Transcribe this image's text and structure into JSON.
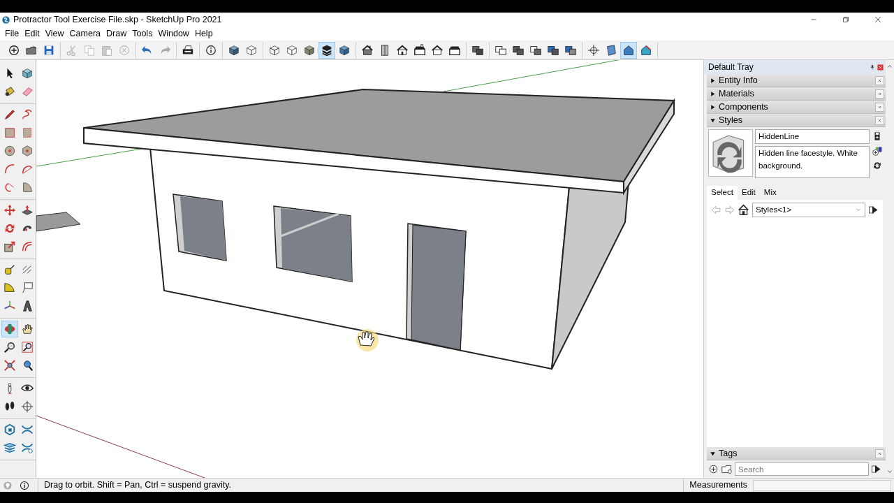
{
  "window": {
    "title": "Protractor Tool Exercise File.skp - SketchUp Pro 2021"
  },
  "menu": [
    "File",
    "Edit",
    "View",
    "Camera",
    "Draw",
    "Tools",
    "Window",
    "Help"
  ],
  "toolbar": [
    {
      "items": [
        {
          "kind": "new",
          "selected": false
        },
        {
          "kind": "open",
          "selected": false
        },
        {
          "kind": "save",
          "selected": false
        }
      ]
    },
    {
      "items": [
        {
          "kind": "cut",
          "selected": false
        },
        {
          "kind": "copy",
          "selected": false
        },
        {
          "kind": "paste",
          "selected": false
        },
        {
          "kind": "erase",
          "selected": false
        }
      ]
    },
    {
      "items": [
        {
          "kind": "undo",
          "selected": false
        },
        {
          "kind": "redo",
          "selected": false
        }
      ]
    },
    {
      "items": [
        {
          "kind": "print",
          "selected": false
        }
      ]
    },
    {
      "items": [
        {
          "kind": "info",
          "selected": false
        }
      ]
    },
    {
      "items": [
        {
          "kind": "xray",
          "selected": false
        },
        {
          "kind": "backedges",
          "selected": false
        }
      ]
    },
    {
      "items": [
        {
          "kind": "wireframe",
          "selected": false
        },
        {
          "kind": "hiddenline",
          "selected": false
        },
        {
          "kind": "shaded",
          "selected": false
        },
        {
          "kind": "textured",
          "selected": true
        },
        {
          "kind": "monochrome",
          "selected": false
        }
      ]
    },
    {
      "items": [
        {
          "kind": "iso",
          "selected": false
        },
        {
          "kind": "top",
          "selected": false
        },
        {
          "kind": "front",
          "selected": false
        },
        {
          "kind": "right",
          "selected": false
        },
        {
          "kind": "back",
          "selected": false
        },
        {
          "kind": "left",
          "selected": false
        }
      ]
    },
    {
      "items": [
        {
          "kind": "shell",
          "selected": false
        }
      ]
    },
    {
      "items": [
        {
          "kind": "intersect",
          "selected": false
        },
        {
          "kind": "union",
          "selected": false
        },
        {
          "kind": "subtract",
          "selected": false
        },
        {
          "kind": "trim",
          "selected": false
        },
        {
          "kind": "split",
          "selected": false
        }
      ]
    },
    {
      "items": [
        {
          "kind": "target",
          "selected": false
        },
        {
          "kind": "viewa",
          "selected": false
        },
        {
          "kind": "viewb",
          "selected": true
        },
        {
          "kind": "viewc",
          "selected": false
        }
      ]
    }
  ],
  "tools": [
    {
      "items": [
        {
          "kind": "select",
          "selected": false
        },
        {
          "kind": "component",
          "selected": false
        },
        {
          "kind": "paint",
          "selected": false
        },
        {
          "kind": "eraser",
          "selected": false
        }
      ]
    },
    {
      "items": [
        {
          "kind": "line",
          "selected": false
        },
        {
          "kind": "freehand",
          "selected": false
        },
        {
          "kind": "rectangle",
          "selected": false
        },
        {
          "kind": "rotrect",
          "selected": false
        },
        {
          "kind": "circle",
          "selected": false
        },
        {
          "kind": "polygon",
          "selected": false
        },
        {
          "kind": "arc",
          "selected": false
        },
        {
          "kind": "arc2",
          "selected": false
        },
        {
          "kind": "arc3",
          "selected": false
        },
        {
          "kind": "pie",
          "selected": false
        }
      ]
    },
    {
      "items": [
        {
          "kind": "move",
          "selected": false
        },
        {
          "kind": "pushpull",
          "selected": false
        },
        {
          "kind": "rotate",
          "selected": false
        },
        {
          "kind": "followme",
          "selected": false
        },
        {
          "kind": "scale",
          "selected": false
        },
        {
          "kind": "offset",
          "selected": false
        }
      ]
    },
    {
      "items": [
        {
          "kind": "tape",
          "selected": false
        },
        {
          "kind": "dimension",
          "selected": false
        },
        {
          "kind": "protractor",
          "selected": false
        },
        {
          "kind": "text",
          "selected": false
        },
        {
          "kind": "axes",
          "selected": false
        },
        {
          "kind": "text3d",
          "selected": false
        }
      ]
    },
    {
      "items": [
        {
          "kind": "orbit",
          "selected": true
        },
        {
          "kind": "pan",
          "selected": false
        },
        {
          "kind": "zoom",
          "selected": false
        },
        {
          "kind": "zoomwindow",
          "selected": false
        },
        {
          "kind": "zoomextents",
          "selected": false
        },
        {
          "kind": "previous",
          "selected": false
        }
      ]
    },
    {
      "items": [
        {
          "kind": "position",
          "selected": false
        },
        {
          "kind": "look",
          "selected": false
        },
        {
          "kind": "walk",
          "selected": false
        },
        {
          "kind": "section",
          "selected": false
        }
      ]
    },
    {
      "items": [
        {
          "kind": "sandbox1",
          "selected": false
        },
        {
          "kind": "sandbox2",
          "selected": false
        },
        {
          "kind": "sandbox3",
          "selected": false
        },
        {
          "kind": "sandbox4",
          "selected": false
        }
      ]
    }
  ],
  "tray": {
    "title": "Default Tray",
    "panels": [
      {
        "title": "Entity Info",
        "expanded": false
      },
      {
        "title": "Materials",
        "expanded": false
      },
      {
        "title": "Components",
        "expanded": false
      },
      {
        "title": "Styles",
        "expanded": true
      }
    ],
    "styles": {
      "name": "HiddenLine",
      "description": "Hidden line facestyle. White background.",
      "tabs": [
        {
          "label": "Select",
          "selected": true
        },
        {
          "label": "Edit",
          "selected": false
        },
        {
          "label": "Mix",
          "selected": false
        }
      ],
      "collection": "Styles<1>"
    },
    "tags": {
      "title": "Tags",
      "expanded": true,
      "search": {
        "placeholder": "Search"
      }
    }
  },
  "status_bar": {
    "message": "Drag to orbit. Shift = Pan, Ctrl = suspend gravity.",
    "measurements_label": "Measurements"
  }
}
